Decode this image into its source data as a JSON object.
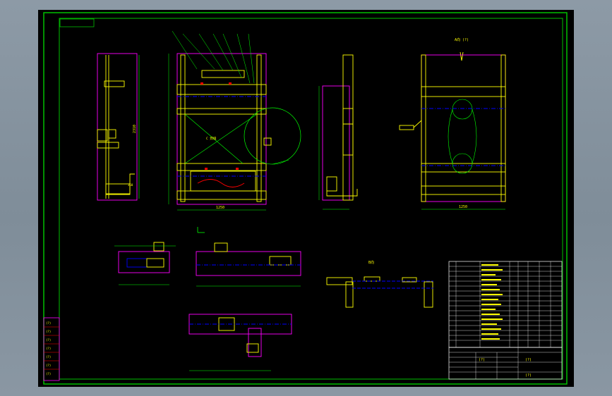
{
  "colors": {
    "background": "#000000",
    "frame": "#00c000",
    "geometry": "#ffff00",
    "outline": "#ff00ff",
    "center_line": "#0000ff",
    "dimension": "#00ff00",
    "text": "#ffff00",
    "window": "#8a96a2"
  },
  "views": {
    "view_a_label": "A向 (?)",
    "view_b_label": "B向",
    "front_total_dim": "1250",
    "side_height_dim": "2310",
    "right_total_dim": "1250",
    "weld_note": "C 焊缝"
  },
  "title_block": {
    "drawing_title": "(?)",
    "drawing_name": "(?)",
    "scale": "(?)"
  },
  "left_margin_box": {
    "rows": [
      "(?)",
      "(?)",
      "(?)",
      "(?)",
      "(?)",
      "(?)",
      "(?)"
    ]
  }
}
